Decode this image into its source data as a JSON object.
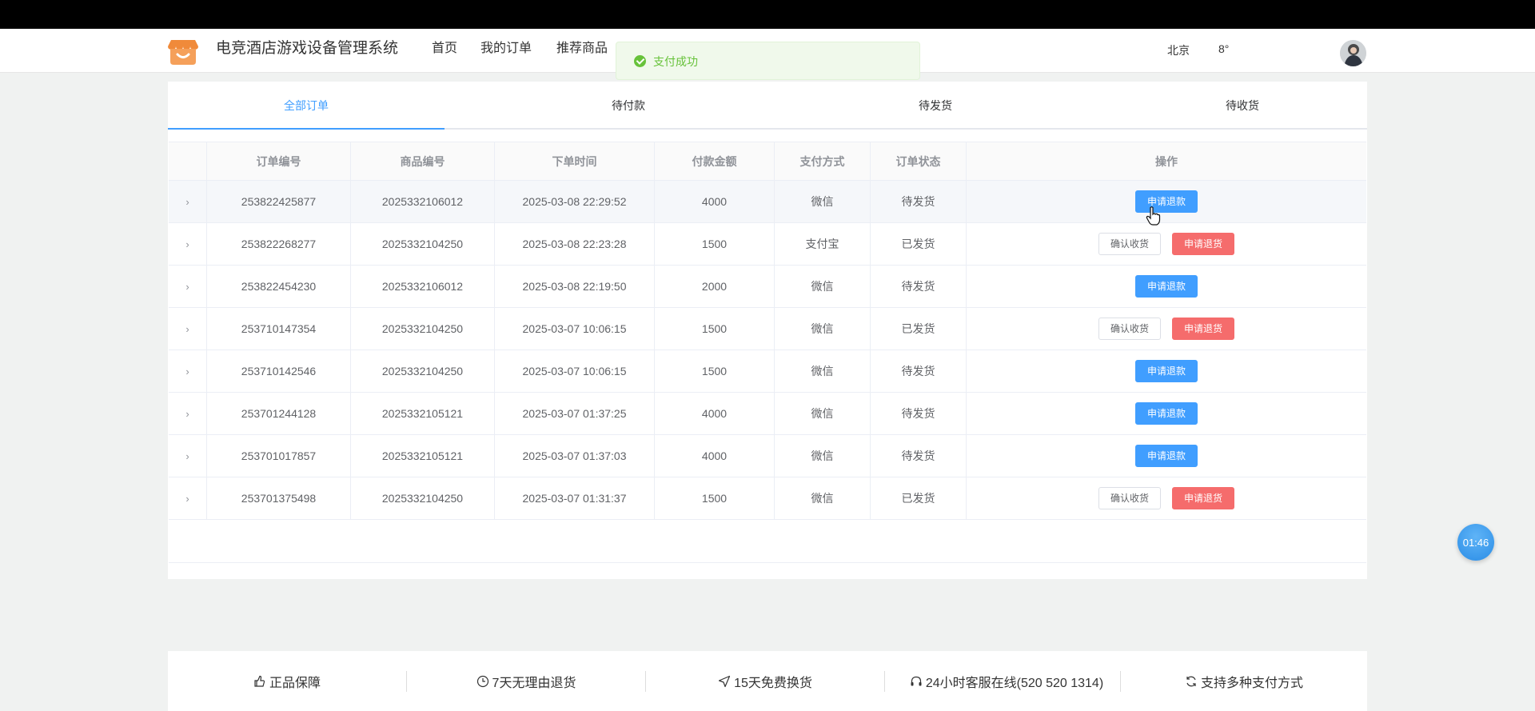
{
  "header": {
    "site_title": "电竞酒店游戏设备管理系统",
    "nav": [
      "首页",
      "我的订单",
      "推荐商品"
    ],
    "city": "北京",
    "temperature": "8°"
  },
  "toast": {
    "message": "支付成功"
  },
  "tabs": [
    {
      "label": "全部订单",
      "active": true
    },
    {
      "label": "待付款",
      "active": false
    },
    {
      "label": "待发货",
      "active": false
    },
    {
      "label": "待收货",
      "active": false
    }
  ],
  "table": {
    "columns": [
      "订单编号",
      "商品编号",
      "下单时间",
      "付款金额",
      "支付方式",
      "订单状态",
      "操作"
    ],
    "rows": [
      {
        "order_no": "253822425877",
        "product_no": "2025332106012",
        "time": "2025-03-08 22:29:52",
        "amount": "4000",
        "payment": "微信",
        "status": "待发货",
        "actions": [
          "申请退款"
        ]
      },
      {
        "order_no": "253822268277",
        "product_no": "2025332104250",
        "time": "2025-03-08 22:23:28",
        "amount": "1500",
        "payment": "支付宝",
        "status": "已发货",
        "actions": [
          "确认收货",
          "申请退货"
        ]
      },
      {
        "order_no": "253822454230",
        "product_no": "2025332106012",
        "time": "2025-03-08 22:19:50",
        "amount": "2000",
        "payment": "微信",
        "status": "待发货",
        "actions": [
          "申请退款"
        ]
      },
      {
        "order_no": "253710147354",
        "product_no": "2025332104250",
        "time": "2025-03-07 10:06:15",
        "amount": "1500",
        "payment": "微信",
        "status": "已发货",
        "actions": [
          "确认收货",
          "申请退货"
        ]
      },
      {
        "order_no": "253710142546",
        "product_no": "2025332104250",
        "time": "2025-03-07 10:06:15",
        "amount": "1500",
        "payment": "微信",
        "status": "待发货",
        "actions": [
          "申请退款"
        ]
      },
      {
        "order_no": "253701244128",
        "product_no": "2025332105121",
        "time": "2025-03-07 01:37:25",
        "amount": "4000",
        "payment": "微信",
        "status": "待发货",
        "actions": [
          "申请退款"
        ]
      },
      {
        "order_no": "253701017857",
        "product_no": "2025332105121",
        "time": "2025-03-07 01:37:03",
        "amount": "4000",
        "payment": "微信",
        "status": "待发货",
        "actions": [
          "申请退款"
        ]
      },
      {
        "order_no": "253701375498",
        "product_no": "2025332104250",
        "time": "2025-03-07 01:31:37",
        "amount": "1500",
        "payment": "微信",
        "status": "已发货",
        "actions": [
          "确认收货",
          "申请退货"
        ]
      }
    ]
  },
  "timer": "01:46",
  "footer": [
    {
      "label": "正品保障",
      "icon": "thumb-icon"
    },
    {
      "label": "7天无理由退货",
      "icon": "clock-icon"
    },
    {
      "label": "15天免费换货",
      "icon": "send-icon"
    },
    {
      "label": "24小时客服在线(520 520 1314)",
      "icon": "headset-icon"
    },
    {
      "label": "支持多种支付方式",
      "icon": "refresh-icon"
    }
  ],
  "colors": {
    "primary": "#409eff",
    "danger": "#f56c6c",
    "success": "#67c23a",
    "logo": "#f08a3a"
  }
}
